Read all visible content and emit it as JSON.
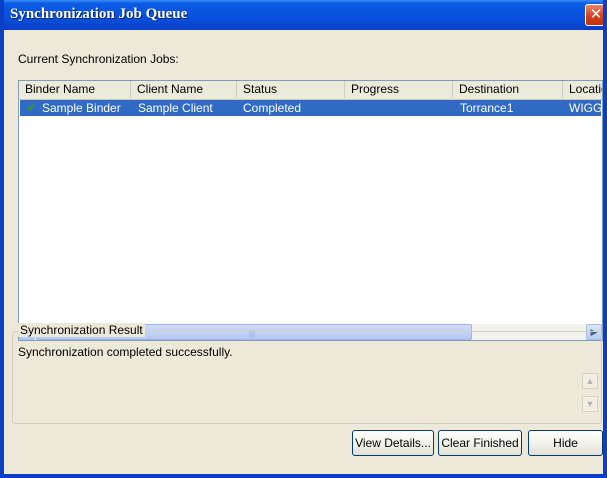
{
  "window": {
    "title": "Synchronization Job Queue",
    "close_glyph": "✕",
    "titlebar_color": "#0a52e0"
  },
  "queue": {
    "label": "Current Synchronization Jobs:",
    "columns": [
      "Binder Name",
      "Client Name",
      "Status",
      "Progress",
      "Destination",
      "Locatio"
    ],
    "rows": [
      {
        "status_icon": "check-icon",
        "binder_name": "Sample Binder",
        "client_name": "Sample Client",
        "status": "Completed",
        "progress": "",
        "destination": "Torrance1",
        "location": "WIGGI"
      }
    ],
    "selected_row_color": "#316ac5"
  },
  "result": {
    "group_label": "Synchronization Result",
    "message": "Synchronization completed successfully."
  },
  "buttons": {
    "view_details": "View Details...",
    "clear_finished": "Clear Finished",
    "hide": "Hide"
  }
}
